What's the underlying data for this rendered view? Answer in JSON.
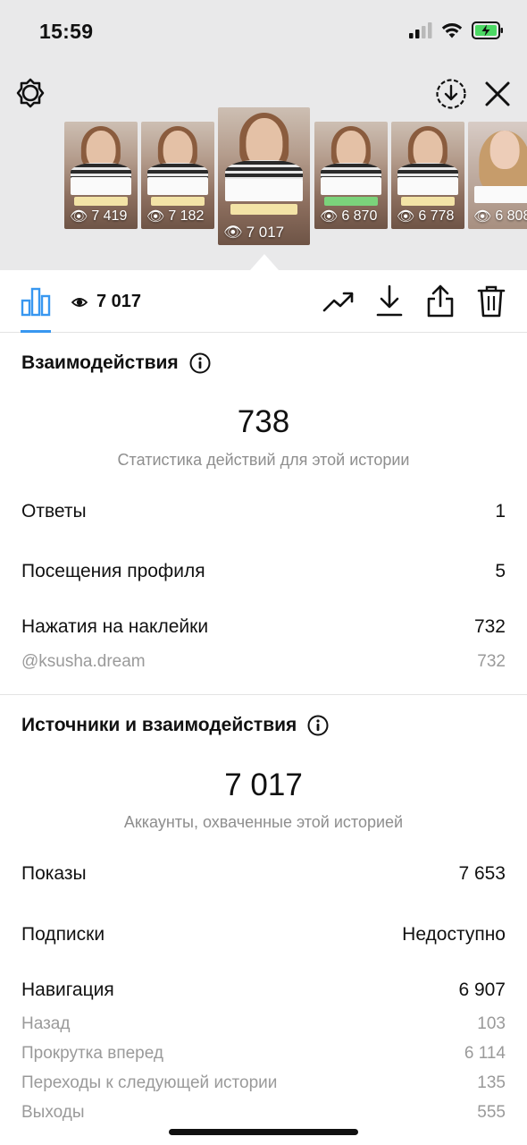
{
  "status_bar": {
    "time": "15:59"
  },
  "stories": [
    {
      "views": "7 419"
    },
    {
      "views": "7 182"
    },
    {
      "views": "7 017",
      "active": true
    },
    {
      "views": "6 870"
    },
    {
      "views": "6 778"
    },
    {
      "views": "6 808"
    }
  ],
  "tabbar": {
    "views_count": "7 017"
  },
  "interactions": {
    "title": "Взаимодействия",
    "total": "738",
    "caption": "Статистика действий для этой истории",
    "rows": [
      {
        "label": "Ответы",
        "value": "1"
      },
      {
        "label": "Посещения профиля",
        "value": "5"
      },
      {
        "label": "Нажатия на наклейки",
        "value": "732"
      }
    ],
    "sub_rows": [
      {
        "label": "@ksusha.dream",
        "value": "732"
      }
    ]
  },
  "discovery": {
    "title": "Источники и взаимодействия",
    "total": "7 017",
    "caption": "Аккаунты, охваченные этой историей",
    "rows": [
      {
        "label": "Показы",
        "value": "7 653"
      },
      {
        "label": "Подписки",
        "value": "Недоступно"
      },
      {
        "label": "Навигация",
        "value": "6 907"
      }
    ],
    "sub_rows": [
      {
        "label": "Назад",
        "value": "103"
      },
      {
        "label": "Прокрутка вперед",
        "value": "6 114"
      },
      {
        "label": "Переходы к следующей истории",
        "value": "135"
      },
      {
        "label": "Выходы",
        "value": "555"
      }
    ]
  },
  "colors": {
    "accent": "#3897f0",
    "battery": "#4cd964",
    "muted": "#8e8e8e"
  },
  "icons": [
    "gear-icon",
    "download-circle-icon",
    "close-icon",
    "bar-chart-icon",
    "eye-icon",
    "trending-icon",
    "download-icon",
    "share-icon",
    "trash-icon",
    "info-icon"
  ]
}
